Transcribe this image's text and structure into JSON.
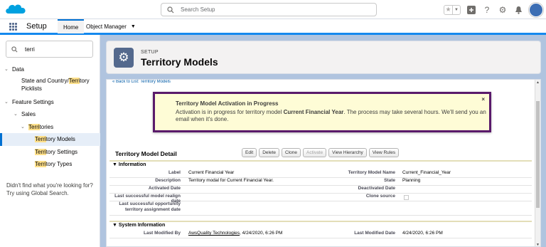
{
  "header": {
    "search_placeholder": "Search Setup"
  },
  "nav": {
    "app_name": "Setup",
    "tabs": [
      "Home",
      "Object Manager"
    ]
  },
  "sidebar": {
    "quickfind_value": "terri",
    "tree": [
      {
        "pre": "",
        "hl": "",
        "post": "Data"
      },
      {
        "pre": "State and Country/",
        "hl": "Terri",
        "post": "tory"
      },
      {
        "pre": "",
        "hl": "",
        "post": "Picklists"
      },
      {
        "pre": "",
        "hl": "",
        "post": "Feature Settings"
      },
      {
        "pre": "",
        "hl": "",
        "post": "Sales"
      },
      {
        "pre": "",
        "hl": "Terri",
        "post": "tories"
      },
      {
        "pre": "",
        "hl": "Terri",
        "post": "tory Models"
      },
      {
        "pre": "",
        "hl": "Terri",
        "post": "tory Settings"
      },
      {
        "pre": "",
        "hl": "Terri",
        "post": "tory Types"
      }
    ],
    "help_line1": "Didn't find what you're looking for?",
    "help_line2": "Try using Global Search."
  },
  "page": {
    "eyebrow": "SETUP",
    "title": "Territory Models",
    "back_link": "« Back to List: Territory Models"
  },
  "alert": {
    "title": "Territory Model Activation in Progress",
    "msg_pre": "Activation is in progress for territory model ",
    "msg_bold": "Current Financial Year",
    "msg_post": ". The process may take several hours. We'll send you an email when it's done.",
    "close": "×"
  },
  "detail": {
    "title": "Territory Model Detail",
    "buttons": [
      "Edit",
      "Delete",
      "Clone",
      "Activate",
      "View Hierarchy",
      "View Rules"
    ],
    "section_info": "Information",
    "section_sys": "System Information",
    "fields": {
      "label_l": "Label",
      "label_v": "Current Financial Year",
      "tmname_l": "Territory Model Name",
      "tmname_v": "Current_Financial_Year",
      "desc_l": "Description",
      "desc_v": "Territory modal for Current Financial Year.",
      "state_l": "State",
      "state_v": "Planning",
      "activated_l": "Activated Date",
      "deactivated_l": "Deactivated Date",
      "realign_l": "Last successful model realign date",
      "clone_l": "Clone source",
      "opp_l1": "Last successful opportunity",
      "opp_l2": "territory assignment date",
      "lmb_l": "Last Modified By",
      "lmb_link": "AwsQuality Technologies",
      "lmb_date": ", 4/24/2020, 6:26 PM",
      "lmd_l": "Last Modified Date",
      "lmd_v": "4/24/2020, 6:26 PM"
    }
  },
  "colors": {
    "accent": "#0070d2",
    "alert_border": "#5a1a6b",
    "alert_bg": "#fefcd6",
    "brand": "#00a1e0"
  }
}
